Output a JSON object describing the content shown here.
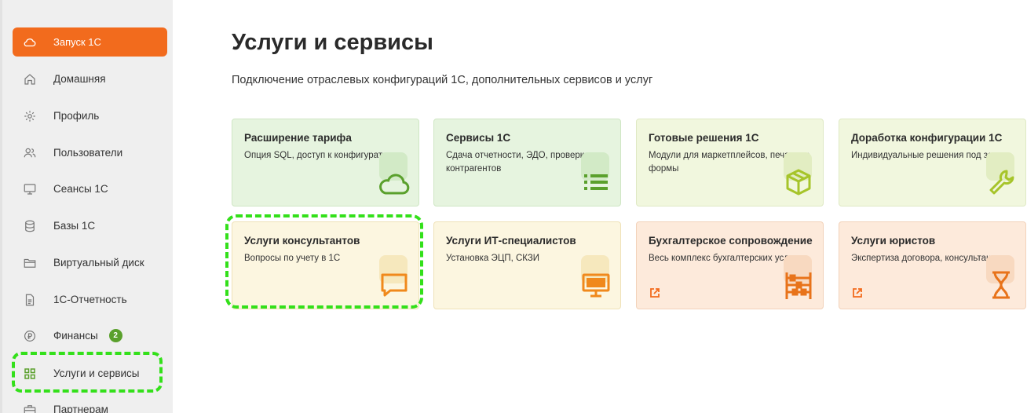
{
  "sidebar": {
    "items": [
      {
        "label": "Запуск 1С",
        "icon": "cloud-icon"
      },
      {
        "label": "Домашняя",
        "icon": "home-icon"
      },
      {
        "label": "Профиль",
        "icon": "gear-icon"
      },
      {
        "label": "Пользователи",
        "icon": "users-icon"
      },
      {
        "label": "Сеансы 1С",
        "icon": "monitor-icon"
      },
      {
        "label": "Базы 1С",
        "icon": "database-icon"
      },
      {
        "label": "Виртуальный диск",
        "icon": "folder-icon"
      },
      {
        "label": "1С-Отчетность",
        "icon": "document-icon"
      },
      {
        "label": "Финансы",
        "icon": "ruble-coin-icon",
        "badge": "2"
      },
      {
        "label": "Услуги и сервисы",
        "icon": "grid-icon"
      },
      {
        "label": "Партнерам",
        "icon": "briefcase-icon"
      }
    ]
  },
  "main": {
    "title": "Услуги и сервисы",
    "subtitle": "Подключение отраслевых конфигураций 1С, дополнительных сервисов и услуг",
    "cards": [
      {
        "title": "Расширение тарифа",
        "desc": "Опция SQL, доступ к конфигуратору",
        "icon": "cloud-icon"
      },
      {
        "title": "Сервисы 1С",
        "desc": "Сдача отчетности, ЭДО, проверка контрагентов",
        "icon": "list-icon"
      },
      {
        "title": "Готовые решения 1С",
        "desc": "Модули для маркетплейсов, печатные формы",
        "icon": "box-icon"
      },
      {
        "title": "Доработка конфигурации 1С",
        "desc": "Индивидуальные решения под заказ",
        "icon": "wrench-icon"
      },
      {
        "title": "Услуги консультантов",
        "desc": "Вопросы по учету в 1С",
        "icon": "chat-icon"
      },
      {
        "title": "Услуги ИТ-специалистов",
        "desc": "Установка ЭЦП, СКЗИ",
        "icon": "monitor-icon"
      },
      {
        "title": "Бухгалтерское сопровождение",
        "desc": "Весь комплекс бухгалтерских услуг",
        "icon": "abacus-icon"
      },
      {
        "title": "Услуги юристов",
        "desc": "Экспертиза договора, консультации",
        "icon": "hourglass-icon"
      }
    ]
  },
  "colors": {
    "accent": "#f26b1d",
    "green_icon": "#5aa02c",
    "lime_icon": "#a6c42a",
    "orange_icon": "#f0891c",
    "highlight": "#33e01a"
  }
}
